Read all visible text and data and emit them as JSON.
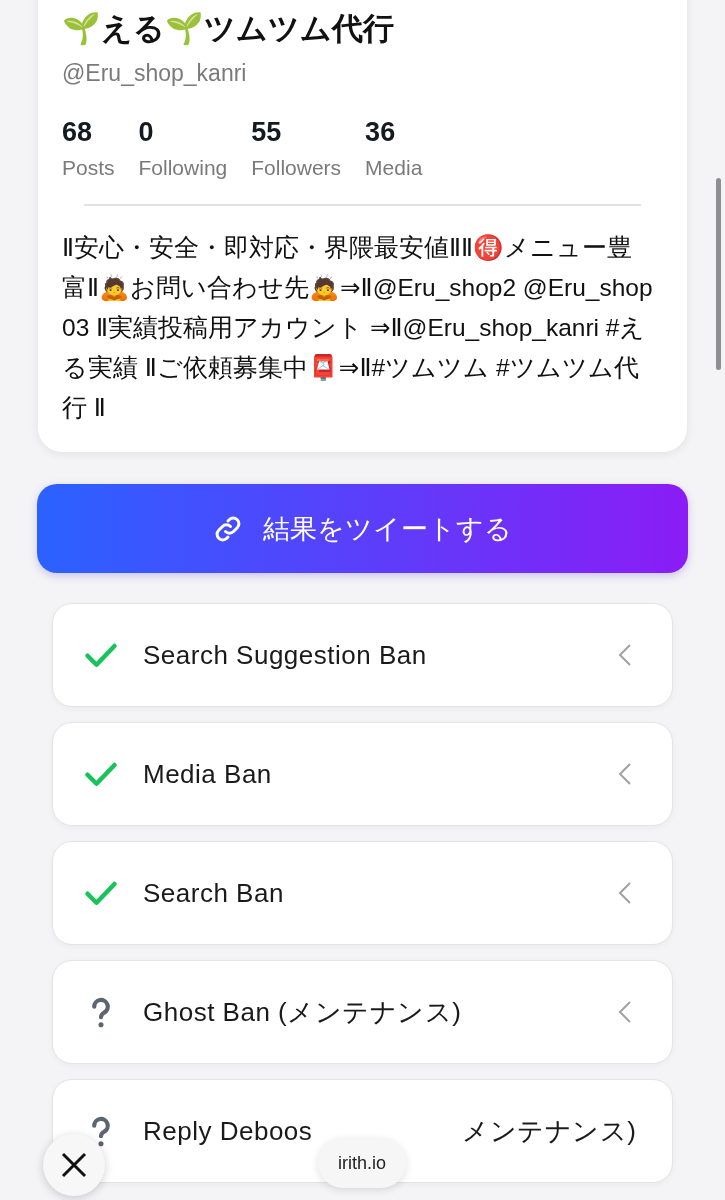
{
  "profile": {
    "name": "🌱える🌱ツムツム代行",
    "handle": "@Eru_shop_kanri",
    "stats": [
      {
        "value": "68",
        "label": "Posts"
      },
      {
        "value": "0",
        "label": "Following"
      },
      {
        "value": "55",
        "label": "Followers"
      },
      {
        "value": "36",
        "label": "Media"
      }
    ],
    "bio": "Ⅱ安心・安全・即対応・界隈最安値ⅡⅡ🉐メニュー豊富Ⅱ🙇お問い合わせ先🙇⇒Ⅱ@Eru_shop2 @Eru_shop03 Ⅱ実績投稿用アカウント ⇒Ⅱ@Eru_shop_kanri #える実績 Ⅱご依頼募集中📮⇒Ⅱ#ツムツム #ツムツム代行 Ⅱ"
  },
  "tweet_button": {
    "label": "結果をツイートする"
  },
  "checks": [
    {
      "label": "Search Suggestion Ban",
      "kind": "ok"
    },
    {
      "label": "Media Ban",
      "kind": "ok"
    },
    {
      "label": "Search Ban",
      "kind": "ok"
    },
    {
      "label": "Ghost Ban (メンテナンス)",
      "kind": "unknown"
    },
    {
      "label": "Reply Deboos",
      "label_after_overlay": "メンテナンス)",
      "kind": "unknown"
    }
  ],
  "domain_badge": "irith.io"
}
